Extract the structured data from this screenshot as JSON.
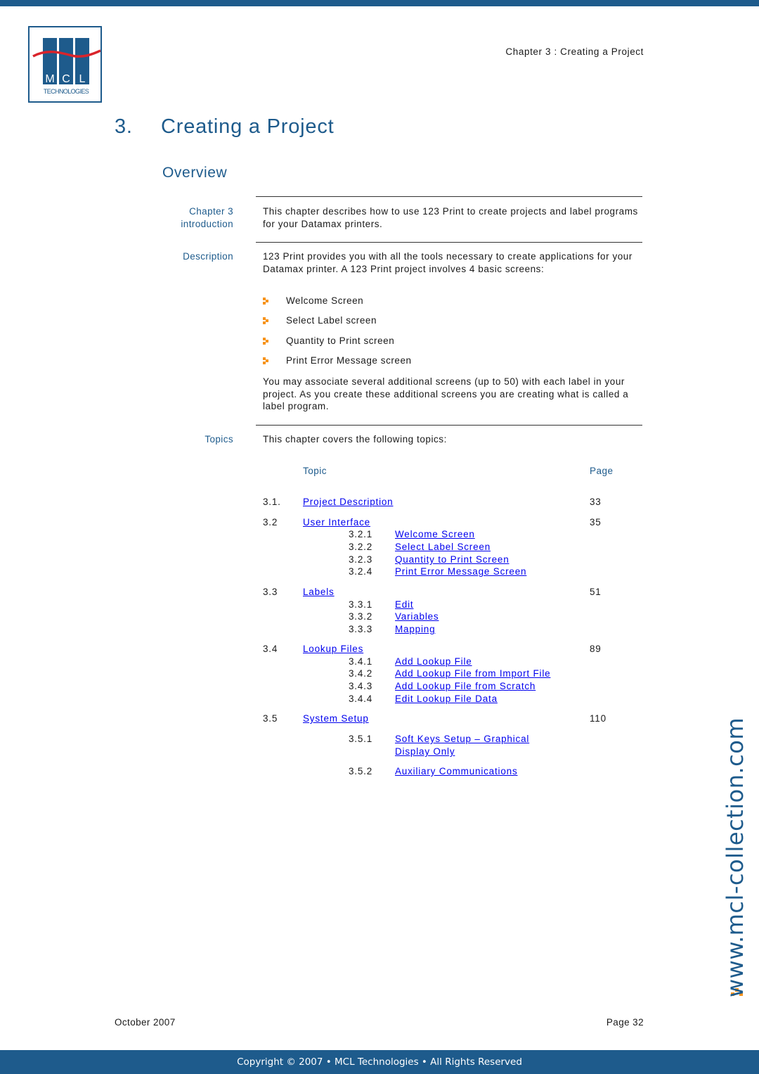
{
  "header": {
    "logo": {
      "letters": [
        "M",
        "C",
        "L"
      ],
      "subtitle": "TECHNOLOGIES",
      "colors": {
        "blue": "#1e5b8c",
        "red": "#d9242b"
      }
    },
    "running_head": "Chapter 3 : Creating a Project"
  },
  "chapter": {
    "number": "3.",
    "title": "Creating a Project"
  },
  "section": {
    "title": "Overview"
  },
  "blocks": {
    "intro": {
      "label_line1": "Chapter 3",
      "label_line2": "introduction",
      "text": "This chapter describes how to use 123 Print to create projects and label programs for your Datamax printers."
    },
    "description": {
      "label": "Description",
      "text": "123 Print provides you with all the tools necessary to create applications for your Datamax printer. A 123 Print project involves 4 basic screens:",
      "bullets": [
        "Welcome Screen",
        "Select Label screen",
        "Quantity to Print screen",
        "Print Error Message screen"
      ],
      "text2": "You may associate several additional screens (up to 50) with each label in your project. As you create these additional screens you are creating what is called a label program."
    },
    "topics": {
      "label": "Topics",
      "text": "This chapter covers the following topics:"
    }
  },
  "toc": {
    "header_topic": "Topic",
    "header_page": "Page",
    "sections": [
      {
        "num": "3.1.",
        "title": "Project Description",
        "page": "33",
        "subs": []
      },
      {
        "num": "3.2",
        "title": "User Interface",
        "page": "35",
        "subs": [
          {
            "num": "3.2.1",
            "title": "Welcome Screen"
          },
          {
            "num": "3.2.2",
            "title": "Select Label Screen"
          },
          {
            "num": "3.2.3",
            "title": "Quantity to Print Screen"
          },
          {
            "num": "3.2.4",
            "title": "Print Error Message Screen"
          }
        ]
      },
      {
        "num": "3.3",
        "title": "Labels",
        "page": "51",
        "subs": [
          {
            "num": "3.3.1",
            "title": "Edit"
          },
          {
            "num": "3.3.2",
            "title": "Variables"
          },
          {
            "num": "3.3.3",
            "title": "Mapping"
          }
        ]
      },
      {
        "num": "3.4",
        "title": "Lookup Files",
        "page": "89",
        "subs": [
          {
            "num": "3.4.1",
            "title": "Add Lookup File"
          },
          {
            "num": "3.4.2",
            "title": "Add Lookup File from Import File"
          },
          {
            "num": "3.4.3",
            "title": "Add Lookup File from Scratch"
          },
          {
            "num": "3.4.4",
            "title": "Edit Lookup File Data"
          }
        ]
      },
      {
        "num": "3.5",
        "title": "System Setup",
        "page": "110",
        "subs": [
          {
            "num": "3.5.1",
            "title": "Soft Keys Setup – Graphical",
            "title_line2": "Display Only"
          },
          {
            "num": "3.5.2",
            "title": "Auxiliary Communications"
          }
        ]
      }
    ]
  },
  "watermark": "www.mcl-collection.com",
  "footer": {
    "date": "October 2007",
    "page": "Page 32",
    "copyright": "Copyright © 2007 • MCL Technologies • All Rights Reserved"
  },
  "colors": {
    "brand_blue": "#1e5b8c",
    "bullet_orange": "#f7941d"
  }
}
